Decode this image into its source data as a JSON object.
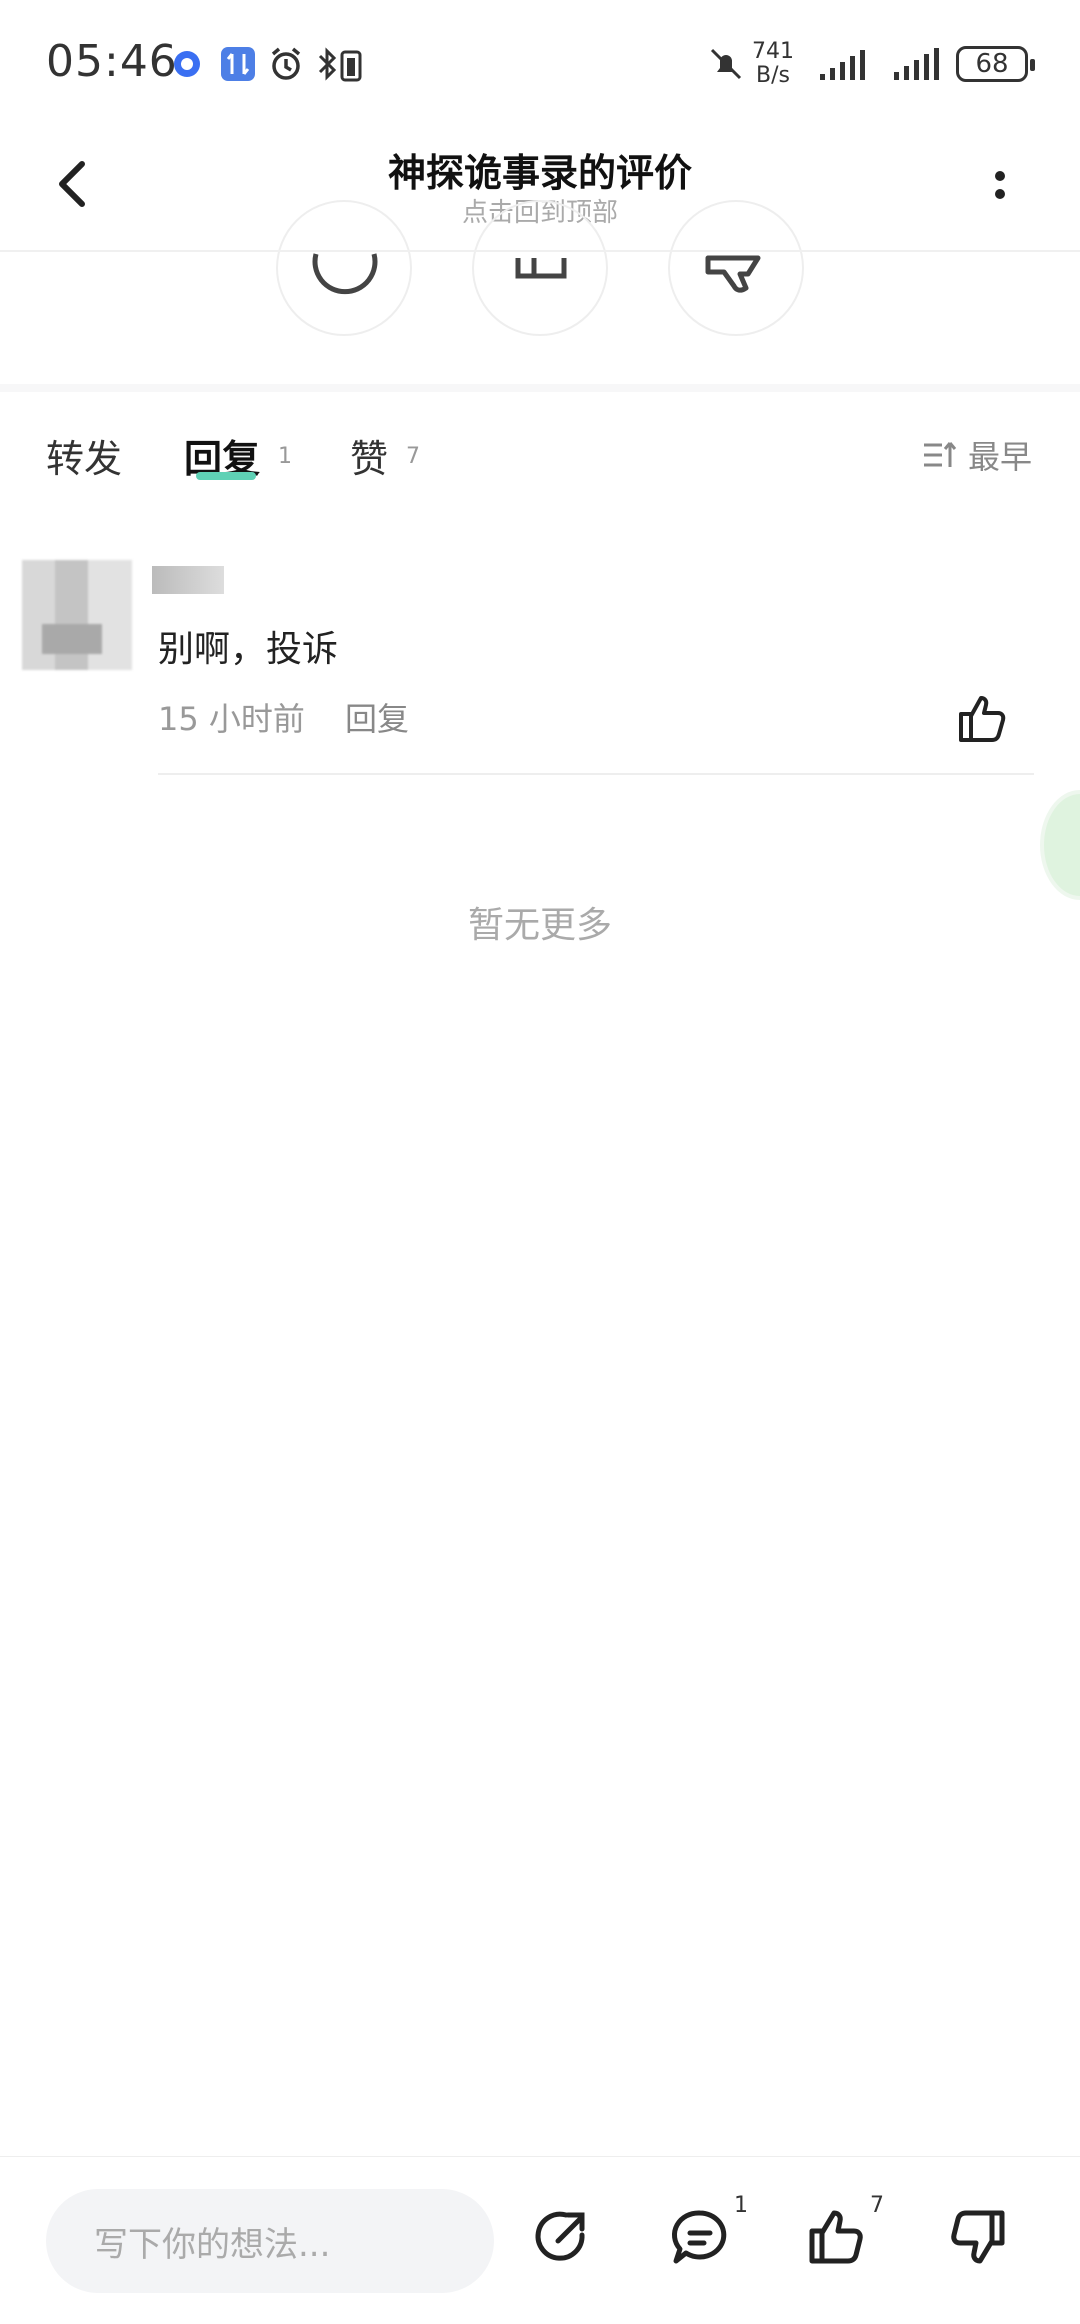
{
  "status_bar": {
    "time": "05:46",
    "speed_value": "741",
    "speed_unit": "B/s",
    "battery": "68"
  },
  "header": {
    "title": "神探诡事录的评价",
    "subtitle": "点击回到顶部"
  },
  "tabs": [
    {
      "label": "转发",
      "count": ""
    },
    {
      "label": "回复",
      "count": "1"
    },
    {
      "label": "赞",
      "count": "7"
    }
  ],
  "sort_label": "最早",
  "comment": {
    "text": "别啊，投诉",
    "time": "15 小时前",
    "reply_label": "回复"
  },
  "no_more": "暂无更多",
  "bottom_bar": {
    "placeholder": "写下你的想法...",
    "comment_count": "1",
    "like_count": "7"
  },
  "colors": {
    "accent": "#5fd1b5",
    "text_muted": "#999999"
  },
  "icons": [
    "back-icon",
    "more-icon",
    "refresh-icon",
    "thumbs-up-icon",
    "thumbs-down-icon",
    "sort-icon",
    "share-icon",
    "comment-icon"
  ]
}
